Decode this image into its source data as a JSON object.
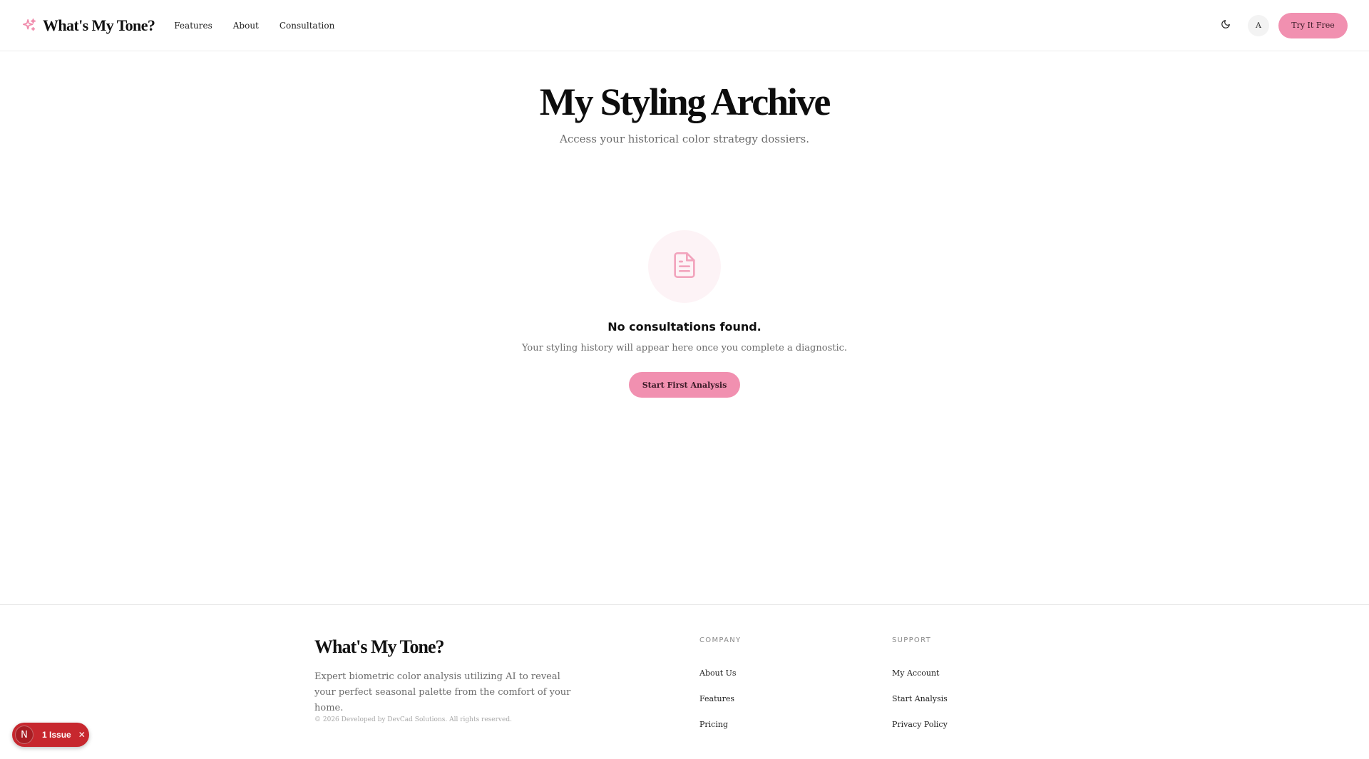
{
  "header": {
    "brand": "What's My Tone?",
    "brand_icon": "sparkle-icon",
    "nav": [
      "Features",
      "About",
      "Consultation"
    ],
    "theme_icon": "moon-icon",
    "avatar_initial": "A",
    "cta_label": "Try It Free"
  },
  "main": {
    "title": "My Styling Archive",
    "subtitle": "Access your historical color strategy dossiers.",
    "empty_state": {
      "icon": "document-icon",
      "title": "No consultations found.",
      "text": "Your styling history will appear here once you complete a diagnostic.",
      "button_label": "Start First Analysis"
    }
  },
  "footer": {
    "brand": "What's My Tone?",
    "description": "Expert biometric color analysis utilizing AI to reveal your perfect seasonal palette from the comfort of your home.",
    "copyright": "© 2026 Developed by DevCad Solutions. All rights reserved.",
    "company": {
      "heading": "COMPANY",
      "links": [
        "About Us",
        "Features",
        "Pricing"
      ]
    },
    "support": {
      "heading": "SUPPORT",
      "links": [
        "My Account",
        "Start Analysis",
        "Privacy Policy"
      ]
    }
  },
  "issue_badge": {
    "initial": "N",
    "label": "1 Issue",
    "close_icon": "close-icon"
  },
  "colors": {
    "accent_pink": "#f190b0",
    "icon_pink": "#f2a4bd",
    "issue_red": "#c7272e"
  }
}
